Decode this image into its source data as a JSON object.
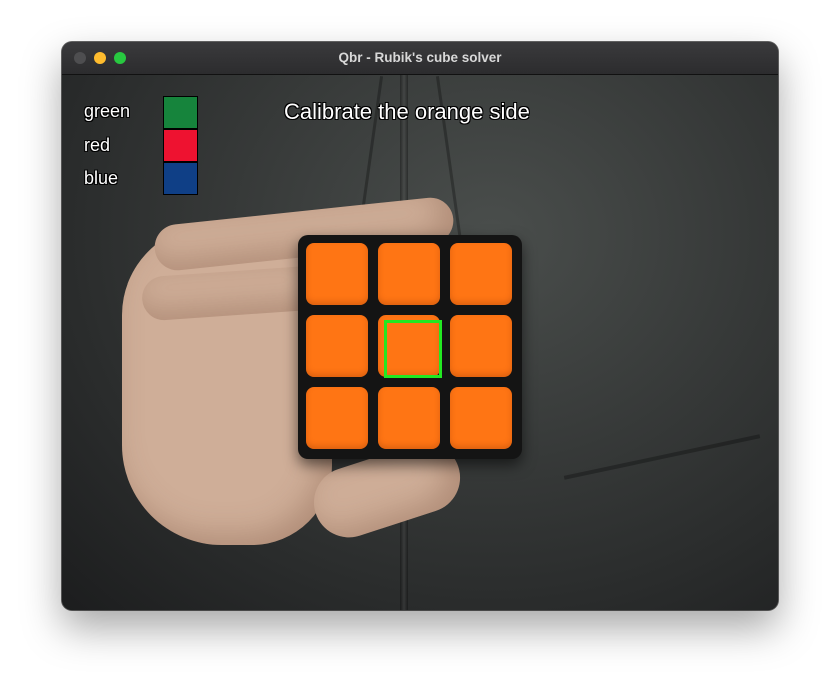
{
  "window": {
    "title": "Qbr - Rubik's cube solver"
  },
  "overlay": {
    "instruction": "Calibrate the orange side",
    "legend": [
      {
        "label": "green",
        "color": "#16843c"
      },
      {
        "label": "red",
        "color": "#ee1230"
      },
      {
        "label": "blue",
        "color": "#0f3f86"
      }
    ]
  },
  "cube": {
    "face_colors": [
      [
        "#ff7514",
        "#ff7514",
        "#ff7514"
      ],
      [
        "#ff7514",
        "#ff7514",
        "#ff7514"
      ],
      [
        "#ff7514",
        "#ff7514",
        "#ff7514"
      ]
    ],
    "target_color": "#22e822"
  }
}
